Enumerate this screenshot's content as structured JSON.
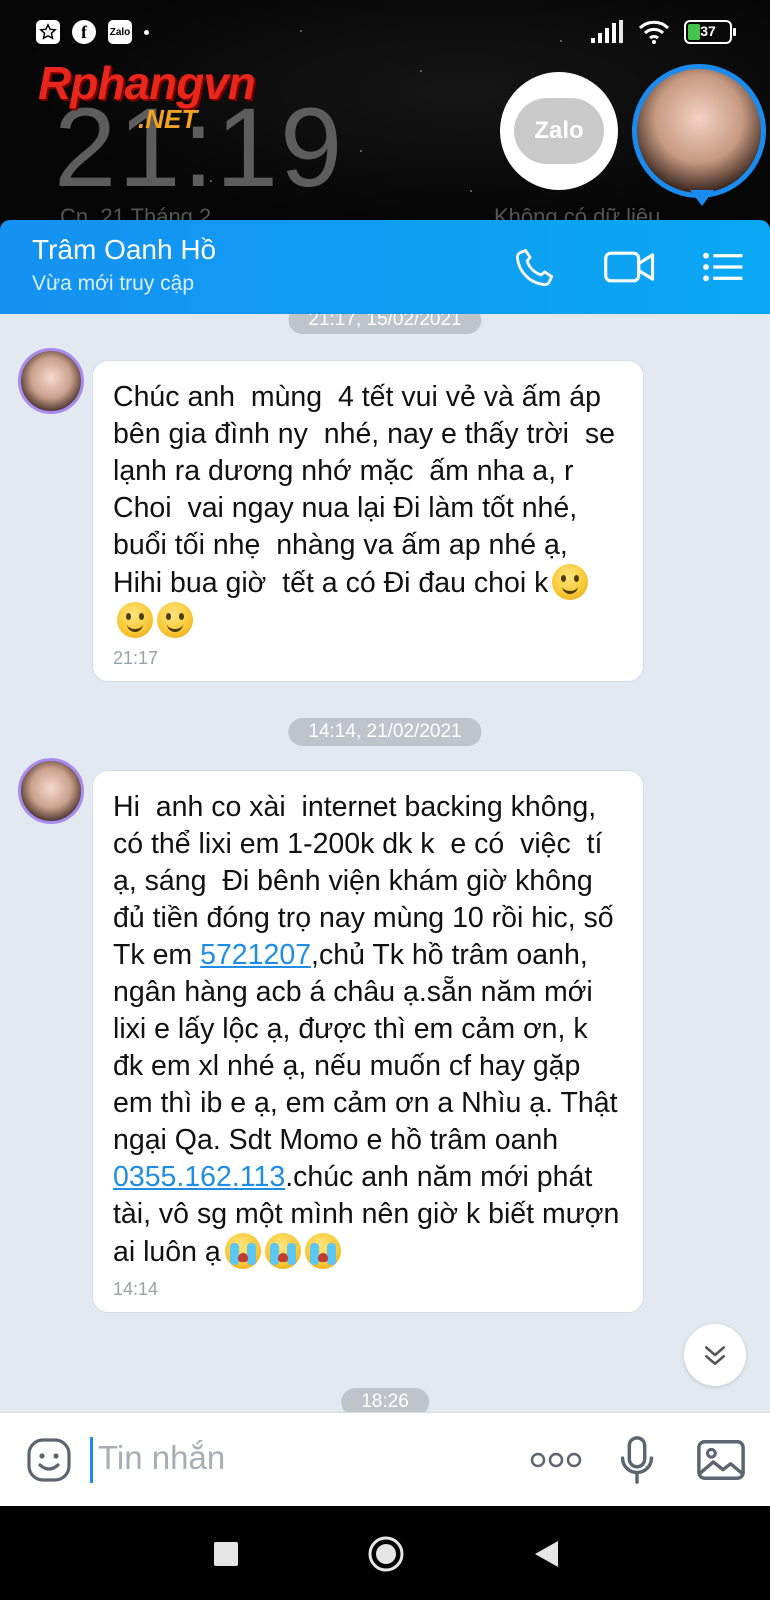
{
  "status_bar": {
    "app_icons": [
      "app-icon",
      "facebook-icon",
      "zalo-icon"
    ],
    "zalo_label": "Zalo",
    "facebook_label": "f",
    "battery_percent": "37",
    "battery_level": 0.37
  },
  "lockscreen": {
    "clock": "21:19",
    "date": "Cn, 21 Tháng 2",
    "no_data": "Không có dữ liệu",
    "zalo_bubble_label": "Zalo"
  },
  "watermark": {
    "main": "Rphangvn",
    "sub": ".NET"
  },
  "header": {
    "contact_name": "Trâm Oanh Hồ",
    "status": "Vừa mới truy cập"
  },
  "messages": [
    {
      "date_pill": "21:17, 15/02/2021",
      "text": "Chúc anh  mùng  4 tết vui vẻ và ấm áp bên gia đình ny  nhé, nay e thấy trời  se lạnh ra dương nhớ mặc  ấm nha a, r Choi  vai ngay nua lại Đi làm tốt nhé, buổi tối nhẹ  nhàng va ấm ap nhé ạ, Hihi bua giờ  tết a có Đi đau choi k",
      "time": "21:17"
    },
    {
      "date_pill": "14:14, 21/02/2021",
      "text_part1": "Hi  anh co xài  internet backing không, có thể lixi em 1-200k dk k  e có  việc  tí  ạ, sáng  Đi bênh viện khám giờ không đủ tiền đóng trọ nay mùng 10 rồi hic, số Tk em ",
      "account_link": "5721207",
      "text_part2": ",chủ Tk hồ trâm oanh, ngân hàng acb á châu ạ.sẵn năm mới lixi e lấy lộc ạ, được thì em cảm ơn, k đk em xl nhé ạ, nếu muốn cf hay gặp em thì ib e ạ, em cảm ơn a Nhìu ạ. Thật ngại Qa. Sdt Momo e hồ trâm oanh ",
      "phone_link": "0355.162.113",
      "text_part3": ".chúc anh năm mới phát tài, vô sg một mình nên giờ k biết mượn ai luôn ạ",
      "time": "14:14"
    },
    {
      "date_pill": "18:26"
    }
  ],
  "input_bar": {
    "placeholder": "Tin nhắn"
  },
  "colors": {
    "header_start": "#1591f1",
    "header_end": "#0aa8f3",
    "link": "#1f8de6",
    "chat_bg": "#e2e9f1"
  }
}
